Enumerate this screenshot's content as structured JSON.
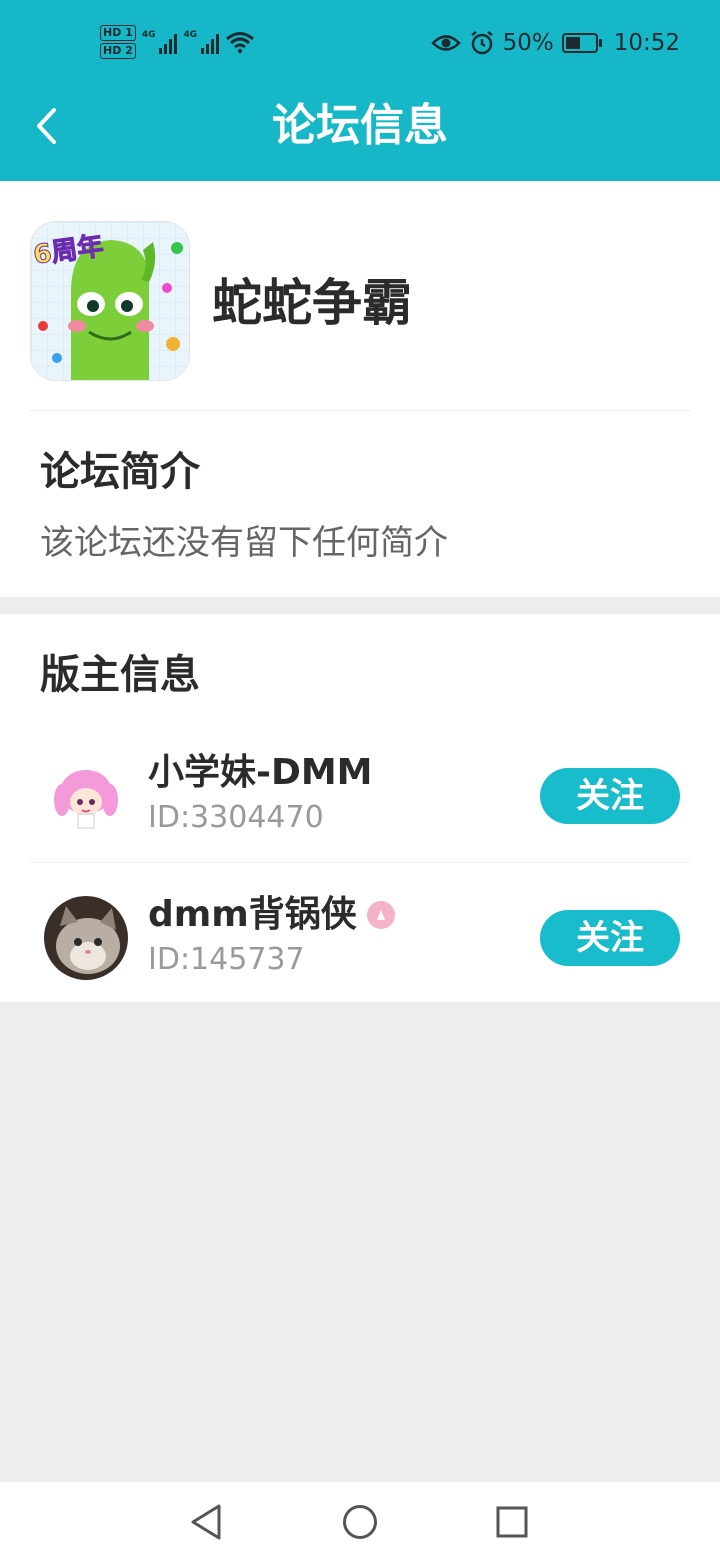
{
  "status_bar": {
    "hd1": "HD 1",
    "hd2": "HD 2",
    "net1": "4G",
    "net2": "4G",
    "battery_text": "50%",
    "battery_level": 0.5,
    "time": "10:52"
  },
  "header": {
    "title": "论坛信息"
  },
  "forum": {
    "name": "蛇蛇争霸",
    "icon_badge": "6周年",
    "intro_title": "论坛简介",
    "intro_text": "该论坛还没有留下任何简介"
  },
  "moderators": {
    "title": "版主信息",
    "items": [
      {
        "name": "小学妹-DMM",
        "id": "ID:3304470",
        "follow": "关注"
      },
      {
        "name": "dmm背锅侠",
        "id": "ID:145737",
        "follow": "关注"
      }
    ]
  },
  "colors": {
    "accent": "#16b8c8",
    "button": "#19bccb",
    "background": "#ededed"
  },
  "icons": [
    "back-arrow-icon",
    "eye-icon",
    "alarm-icon",
    "battery-icon",
    "wifi-icon",
    "signal-icon",
    "nav-back-icon",
    "nav-home-icon",
    "nav-recents-icon"
  ]
}
